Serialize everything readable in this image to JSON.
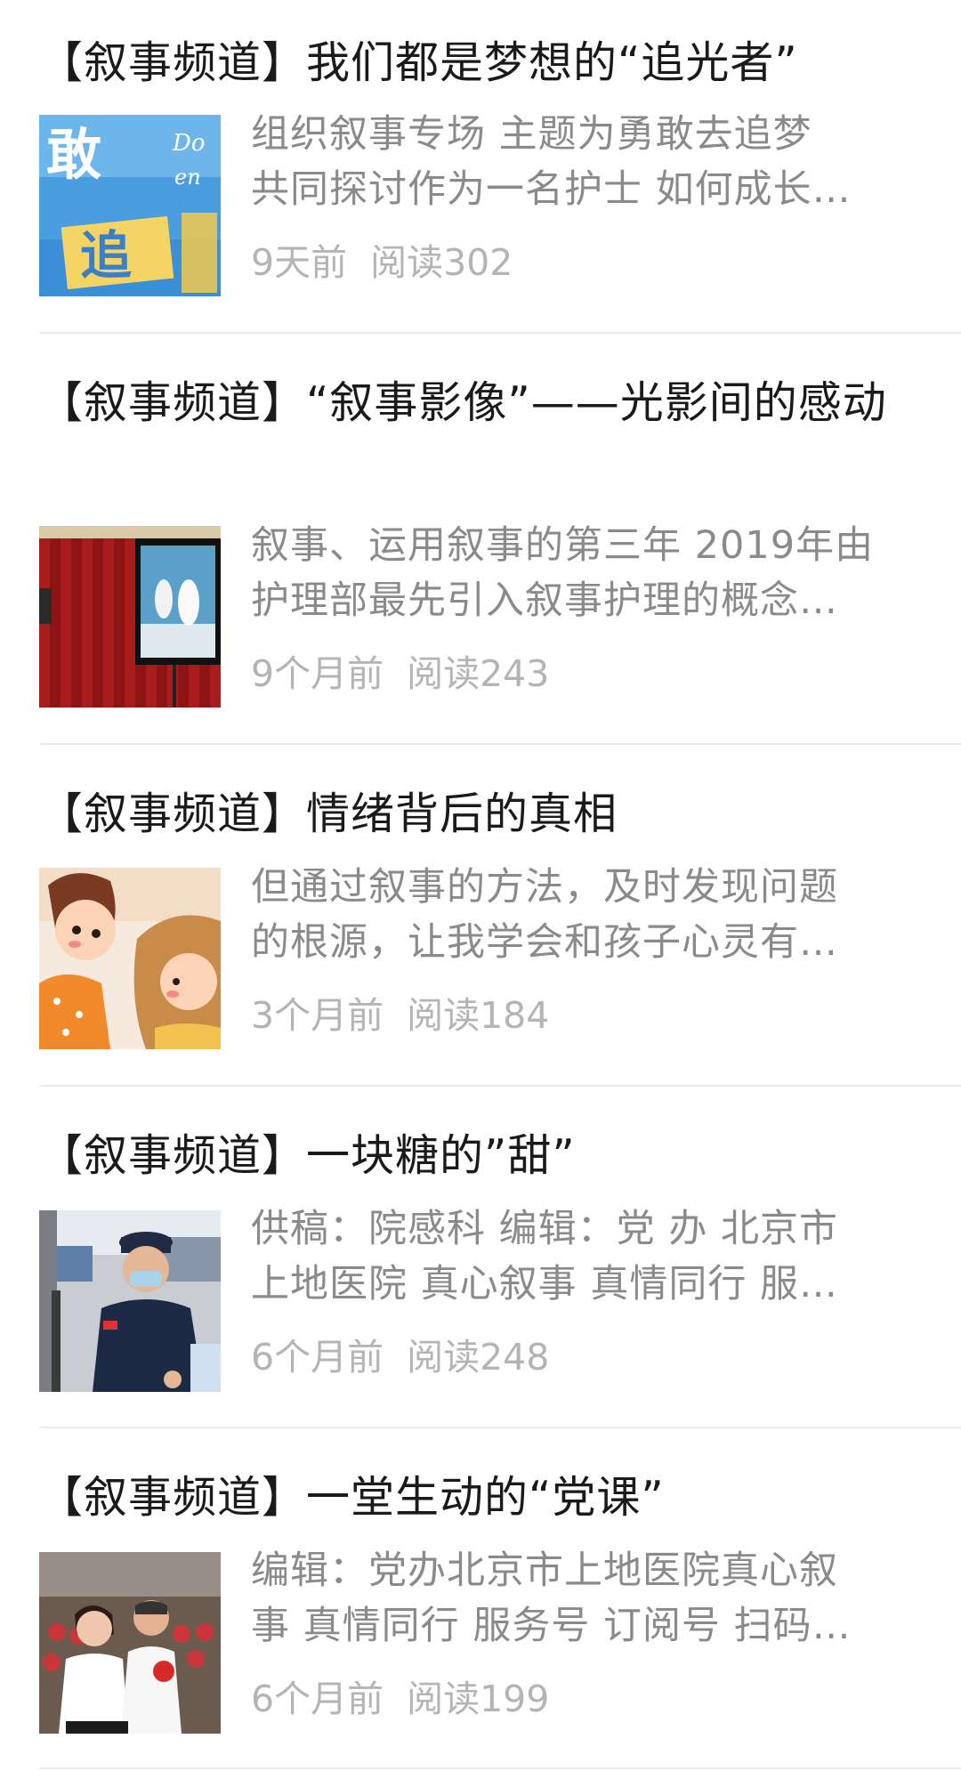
{
  "articles": [
    {
      "title": "【叙事频道】我们都是梦想的“追光者”",
      "summary_lines": [
        "组织叙事专场 主题为勇敢去追梦",
        "共同探讨作为一名护士 如何成长…"
      ],
      "time": "9天前",
      "reads": "阅读302",
      "thumb_text": [
        "敢",
        "追",
        "Do",
        "en"
      ],
      "thumb_icon": "poster-thumbnail"
    },
    {
      "title": "【叙事频道】“叙事影像”——光影间的感动",
      "summary_lines": [
        "叙事、运用叙事的第三年 2019年由",
        "护理部最先引入叙事护理的概念…"
      ],
      "time": "9个月前",
      "reads": "阅读243",
      "thumb_icon": "stage-screen-thumbnail"
    },
    {
      "title": "【叙事频道】情绪背后的真相",
      "summary_lines": [
        "但通过叙事的方法，及时发现问题",
        "的根源，让我学会和孩子心灵有…"
      ],
      "time": "3个月前",
      "reads": "阅读184",
      "thumb_icon": "cartoon-thumbnail"
    },
    {
      "title": "【叙事频道】一块糖的”甜”",
      "summary_lines": [
        "供稿：院感科 编辑：党 办 北京市",
        "上地医院 真心叙事 真情同行 服…"
      ],
      "time": "6个月前",
      "reads": "阅读248",
      "thumb_icon": "guard-photo-thumbnail"
    },
    {
      "title": "【叙事频道】一堂生动的“党课”",
      "summary_lines": [
        "编辑：党办北京市上地医院真心叙",
        "事 真情同行 服务号 订阅号 扫码…"
      ],
      "time": "6个月前",
      "reads": "阅读199",
      "thumb_icon": "ceremony-photo-thumbnail"
    }
  ]
}
